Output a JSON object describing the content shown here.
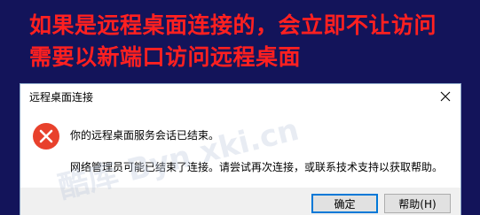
{
  "overlay": {
    "line1": "如果是远程桌面连接的，会立即不让访问",
    "line2": "需要以新端口访问远程桌面"
  },
  "dialog": {
    "title": "远程桌面连接",
    "icon": "error-icon",
    "message_primary": "你的远程桌面服务会话已结束。",
    "message_secondary": "网络管理员可能已结束了连接。请尝试再次连接，或联系技术支持以获取帮助。",
    "buttons": {
      "ok": "确定",
      "help": "帮助(H)"
    }
  },
  "watermark": "酷库 Byn xki.cn"
}
